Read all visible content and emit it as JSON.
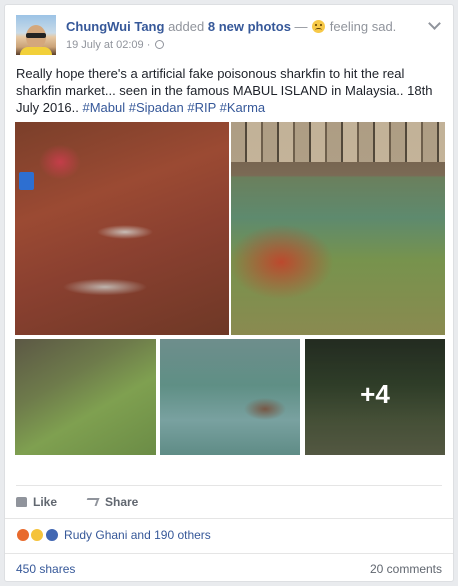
{
  "post": {
    "author": "ChungWui Tang",
    "action_text": "added",
    "photos_link": "8 new photos",
    "feeling_dash": "—",
    "feeling_text": "feeling sad.",
    "timestamp": "19 July at 02:09 ·",
    "body_text": "Really hope there's a artificial fake poisonous sharkfin to hit the real sharkfin market... seen in the famous MABUL ISLAND in Malaysia.. 18th July 2016..",
    "hashtags": [
      "#Mabul",
      "#Sipadan",
      "#RIP",
      "#Karma"
    ],
    "more_photos_label": "+4"
  },
  "actions": {
    "like_label": "Like",
    "share_label": "Share"
  },
  "reactions": {
    "summary": "Rudy Ghani and 190 others"
  },
  "footer": {
    "shares": "450 shares",
    "comments": "20 comments"
  },
  "icons": [
    "globe-icon",
    "chevron-down-icon",
    "sad-emoji-icon",
    "like-icon",
    "share-icon",
    "angry-reaction-icon",
    "sad-reaction-icon",
    "like-reaction-icon"
  ]
}
